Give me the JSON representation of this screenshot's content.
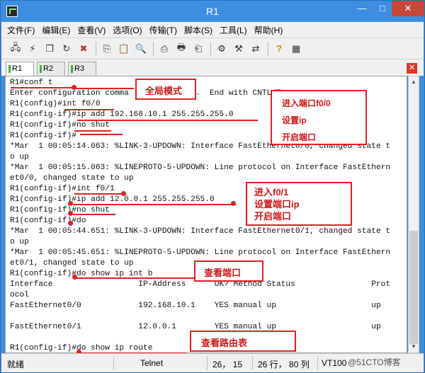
{
  "window": {
    "title": "R1"
  },
  "menu": [
    "文件(F)",
    "编辑(E)",
    "查看(V)",
    "选项(O)",
    "传输(T)",
    "脚本(S)",
    "工具(L)",
    "帮助(H)"
  ],
  "toolbar": {
    "icons": [
      "connect-icon",
      "quick-connect-icon",
      "connect-tab-icon",
      "reconnect-icon",
      "disconnect-icon",
      "copy-icon",
      "paste-icon",
      "find-icon",
      "print-setup-icon",
      "print-icon",
      "print-screen-icon",
      "session-options-icon",
      "global-options-icon",
      "sftp-icon",
      "help-icon",
      "map-icon"
    ]
  },
  "tabs": [
    {
      "label": "R1",
      "active": true
    },
    {
      "label": "R2",
      "active": false
    },
    {
      "label": "R3",
      "active": false
    }
  ],
  "terminal": {
    "lines": [
      "R1#conf t",
      "Enter configuration comma          line.  End with CNTL/Z.",
      "R1(config)#int f0/0",
      "R1(config-if)#ip add 192.168.10.1 255.255.255.0",
      "R1(config-if)#no shut",
      "R1(config-if)#",
      "*Mar  1 00:05:14.063: %LINK-3-UPDOWN: Interface FastEthernet0/0, changed state t",
      "o up",
      "*Mar  1 00:05:15.063: %LINEPROTO-5-UPDOWN: Line protocol on Interface FastEthern",
      "et0/0, changed state to up",
      "R1(config-if)#int f0/1",
      "R1(config-if)#ip add 12.0.0.1 255.255.255.0",
      "R1(config-if)#no shut",
      "R1(config-if)#do",
      "*Mar  1 00:05:44.651: %LINK-3-UPDOWN: Interface FastEthernet0/1, changed state t",
      "o up",
      "*Mar  1 00:05:45.651: %LINEPROTO-5-UPDOWN: Line protocol on Interface FastEthern",
      "et0/1, changed state to up",
      "R1(config-if)#do show ip int b",
      "Interface                  IP-Address      OK? Method Status                Prot",
      "ocol",
      "FastEthernet0/0            192.168.10.1    YES manual up                    up",
      "",
      "FastEthernet0/1            12.0.0.1        YES manual up                    up",
      "",
      "R1(config-if)#do show ip route"
    ]
  },
  "annotations": {
    "global_mode": "全局模式",
    "f00_enter": "进入端口f0/0",
    "f00_setip": "设置ip",
    "f00_open": "开启端口",
    "f01_enter": "进入f0/1",
    "f01_setip": "设置端口ip",
    "f01_open": "开启端口",
    "view_port": "查看端口",
    "view_route": "查看路由表"
  },
  "status": {
    "ready": "就绪",
    "protocol": "Telnet",
    "cursor_pos": "26， 15",
    "size": "26 行， 80 列",
    "terminal_type": "VT100",
    "watermark": "@51CTO博客"
  }
}
